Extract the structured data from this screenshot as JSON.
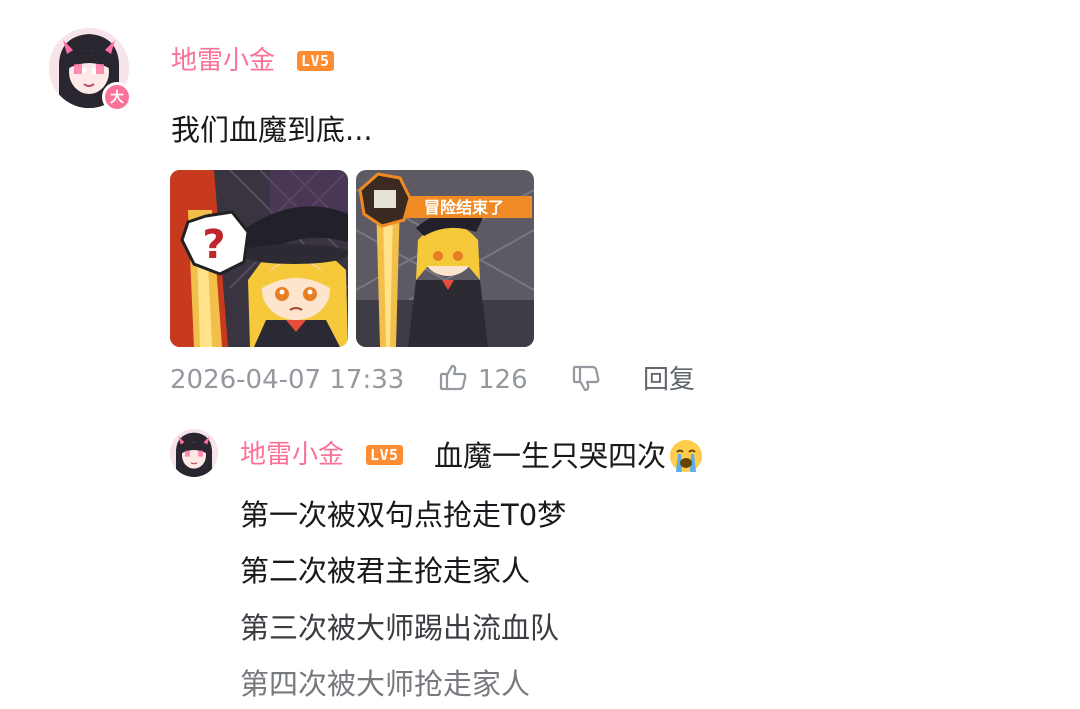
{
  "comment": {
    "username": "地雷小金",
    "level": "LV5",
    "avatar_badge": "大",
    "text": "我们血魔到底...",
    "images": [
      {
        "name": "question-mark-reaction-image",
        "caption": ""
      },
      {
        "name": "adventure-over-reaction-image",
        "caption": "冒险结束了"
      }
    ],
    "time": "2026-04-07 17:33",
    "like_count": "126",
    "reply_label": "回复"
  },
  "reply": {
    "username": "地雷小金",
    "level": "LV5",
    "first_line": "血魔一生只哭四次",
    "emoji": "loudly-crying-face",
    "lines": [
      "第一次被双句点抢走T0梦",
      "第二次被君主抢走家人",
      "第三次被大师踢出流血队",
      "第四次被大师抢走家人"
    ]
  },
  "colors": {
    "username": "#fb7299",
    "level_badge": "#ff8c31",
    "meta_text": "#9499a0",
    "body_text": "#18191c"
  }
}
